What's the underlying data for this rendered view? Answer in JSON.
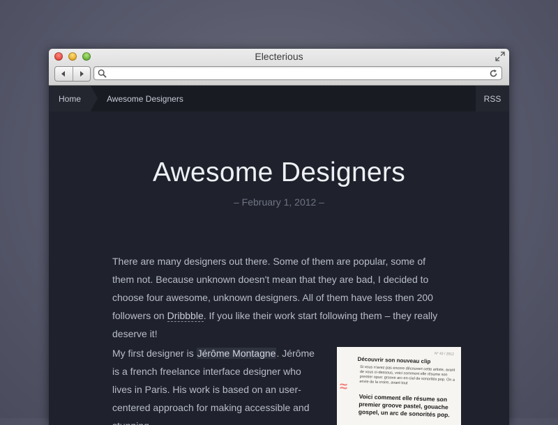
{
  "window": {
    "title": "Electerious"
  },
  "address": {
    "value": "",
    "placeholder": ""
  },
  "breadcrumb": {
    "home": "Home",
    "current": "Awesome Designers",
    "rss": "RSS"
  },
  "post": {
    "title": "Awesome Designers",
    "date": "– February 1, 2012 –",
    "p1_before": "There are many designers out there. Some of them are popular, some of them not. Because unknown doesn't mean that they are bad, I decided to choose four awesome, unknown designers. All of them have less then 200 followers on ",
    "p1_link": "Dribbble",
    "p1_after": ". If you like their work start following them – they really deserve it!",
    "p2_before": "My first designer is ",
    "p2_link": "Jérôme Montagne",
    "p2_after": ". Jérôme is a french freelance interface designer who lives in Paris. His work is based on an user-centered approach for making accessible and stunning"
  },
  "thumbnail": {
    "meta": "N° 42 / 2012",
    "heading": "Découvrir son nouveau clip",
    "lines": "Si vous n'avez pas encore découvert cette artiste, avant de vous ci-dessous, voici comment elle résume son premier opus: groove arc-en-ciel de sonorités pop. On a envie de la croire, avant tout",
    "glyph": "≈",
    "quote": "Voici comment elle résume son premier groove pastel, gouache gospel, un arc de sonorités pop."
  },
  "colors": {
    "page_bg": "#1f222c",
    "sitebar_bg": "#191b23",
    "accent_pink": "#f0817d"
  }
}
